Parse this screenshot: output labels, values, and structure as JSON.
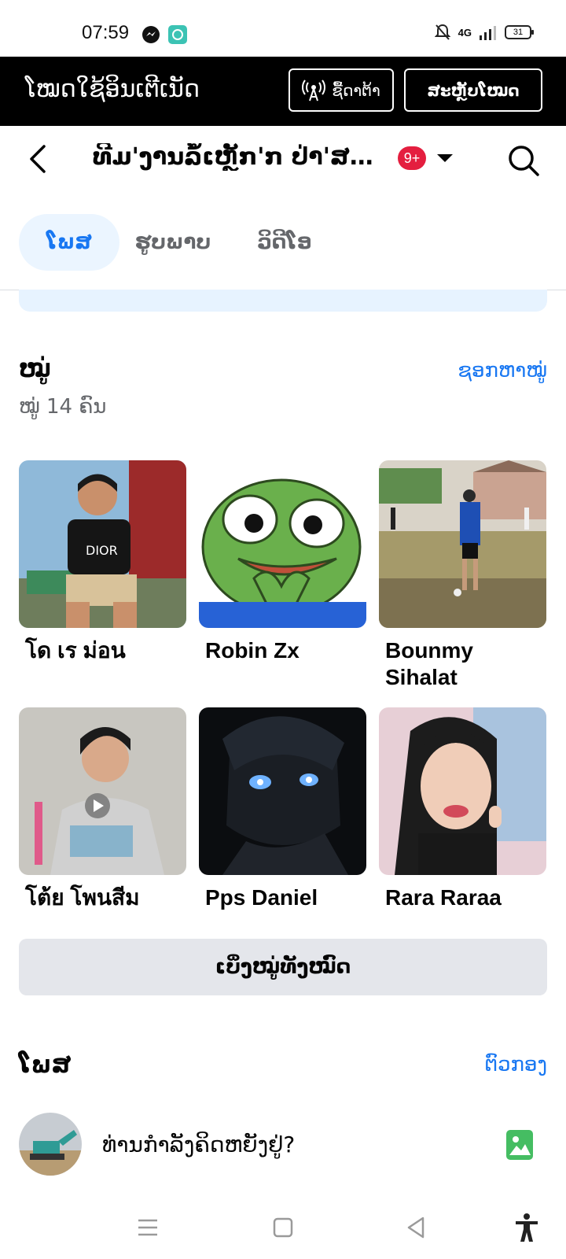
{
  "status_bar": {
    "time": "07:59",
    "network": "4G",
    "battery": "31"
  },
  "free_mode": {
    "title": "ໂໝດໃຊ້ອິນເຕີເນັດ",
    "data_button": "ຊື້ດາຕ້າ",
    "switch_button": "ສະຫຼັບໂໝດ"
  },
  "group_header": {
    "title": "ທີມ'ງານລໍ້ເຫຼັກ'ກ ປ່າ'ສອ...",
    "badge": "9+"
  },
  "tabs": [
    {
      "label": "ໂພສ",
      "active": true
    },
    {
      "label": "ຮູບພາບ",
      "active": false
    },
    {
      "label": "ວິດີໂອ",
      "active": false
    }
  ],
  "members": {
    "title": "ໝູ່",
    "find_link": "ຊອກຫາໝູ່",
    "count_text": "ໝູ່ 14 ຄົນ",
    "list": [
      {
        "name": "โด เร ม่อน"
      },
      {
        "name": "Robin Zx"
      },
      {
        "name": "Bounmy Sihalat"
      },
      {
        "name": "โต้ย โพนสีม"
      },
      {
        "name": "Pps Daniel"
      },
      {
        "name": "Rara Raraa"
      }
    ],
    "see_all": "ເບິ່ງໝູ່ທັງໝົດ"
  },
  "posts": {
    "title": "ໂພສ",
    "filter_link": "ຕົວກອງ",
    "composer_prompt": "ທ່ານກຳລັງຄິດຫຍັງຢູ່?"
  },
  "colors": {
    "accent": "#1877f2",
    "badge": "#e41e3f",
    "photo_icon": "#45bd62"
  }
}
